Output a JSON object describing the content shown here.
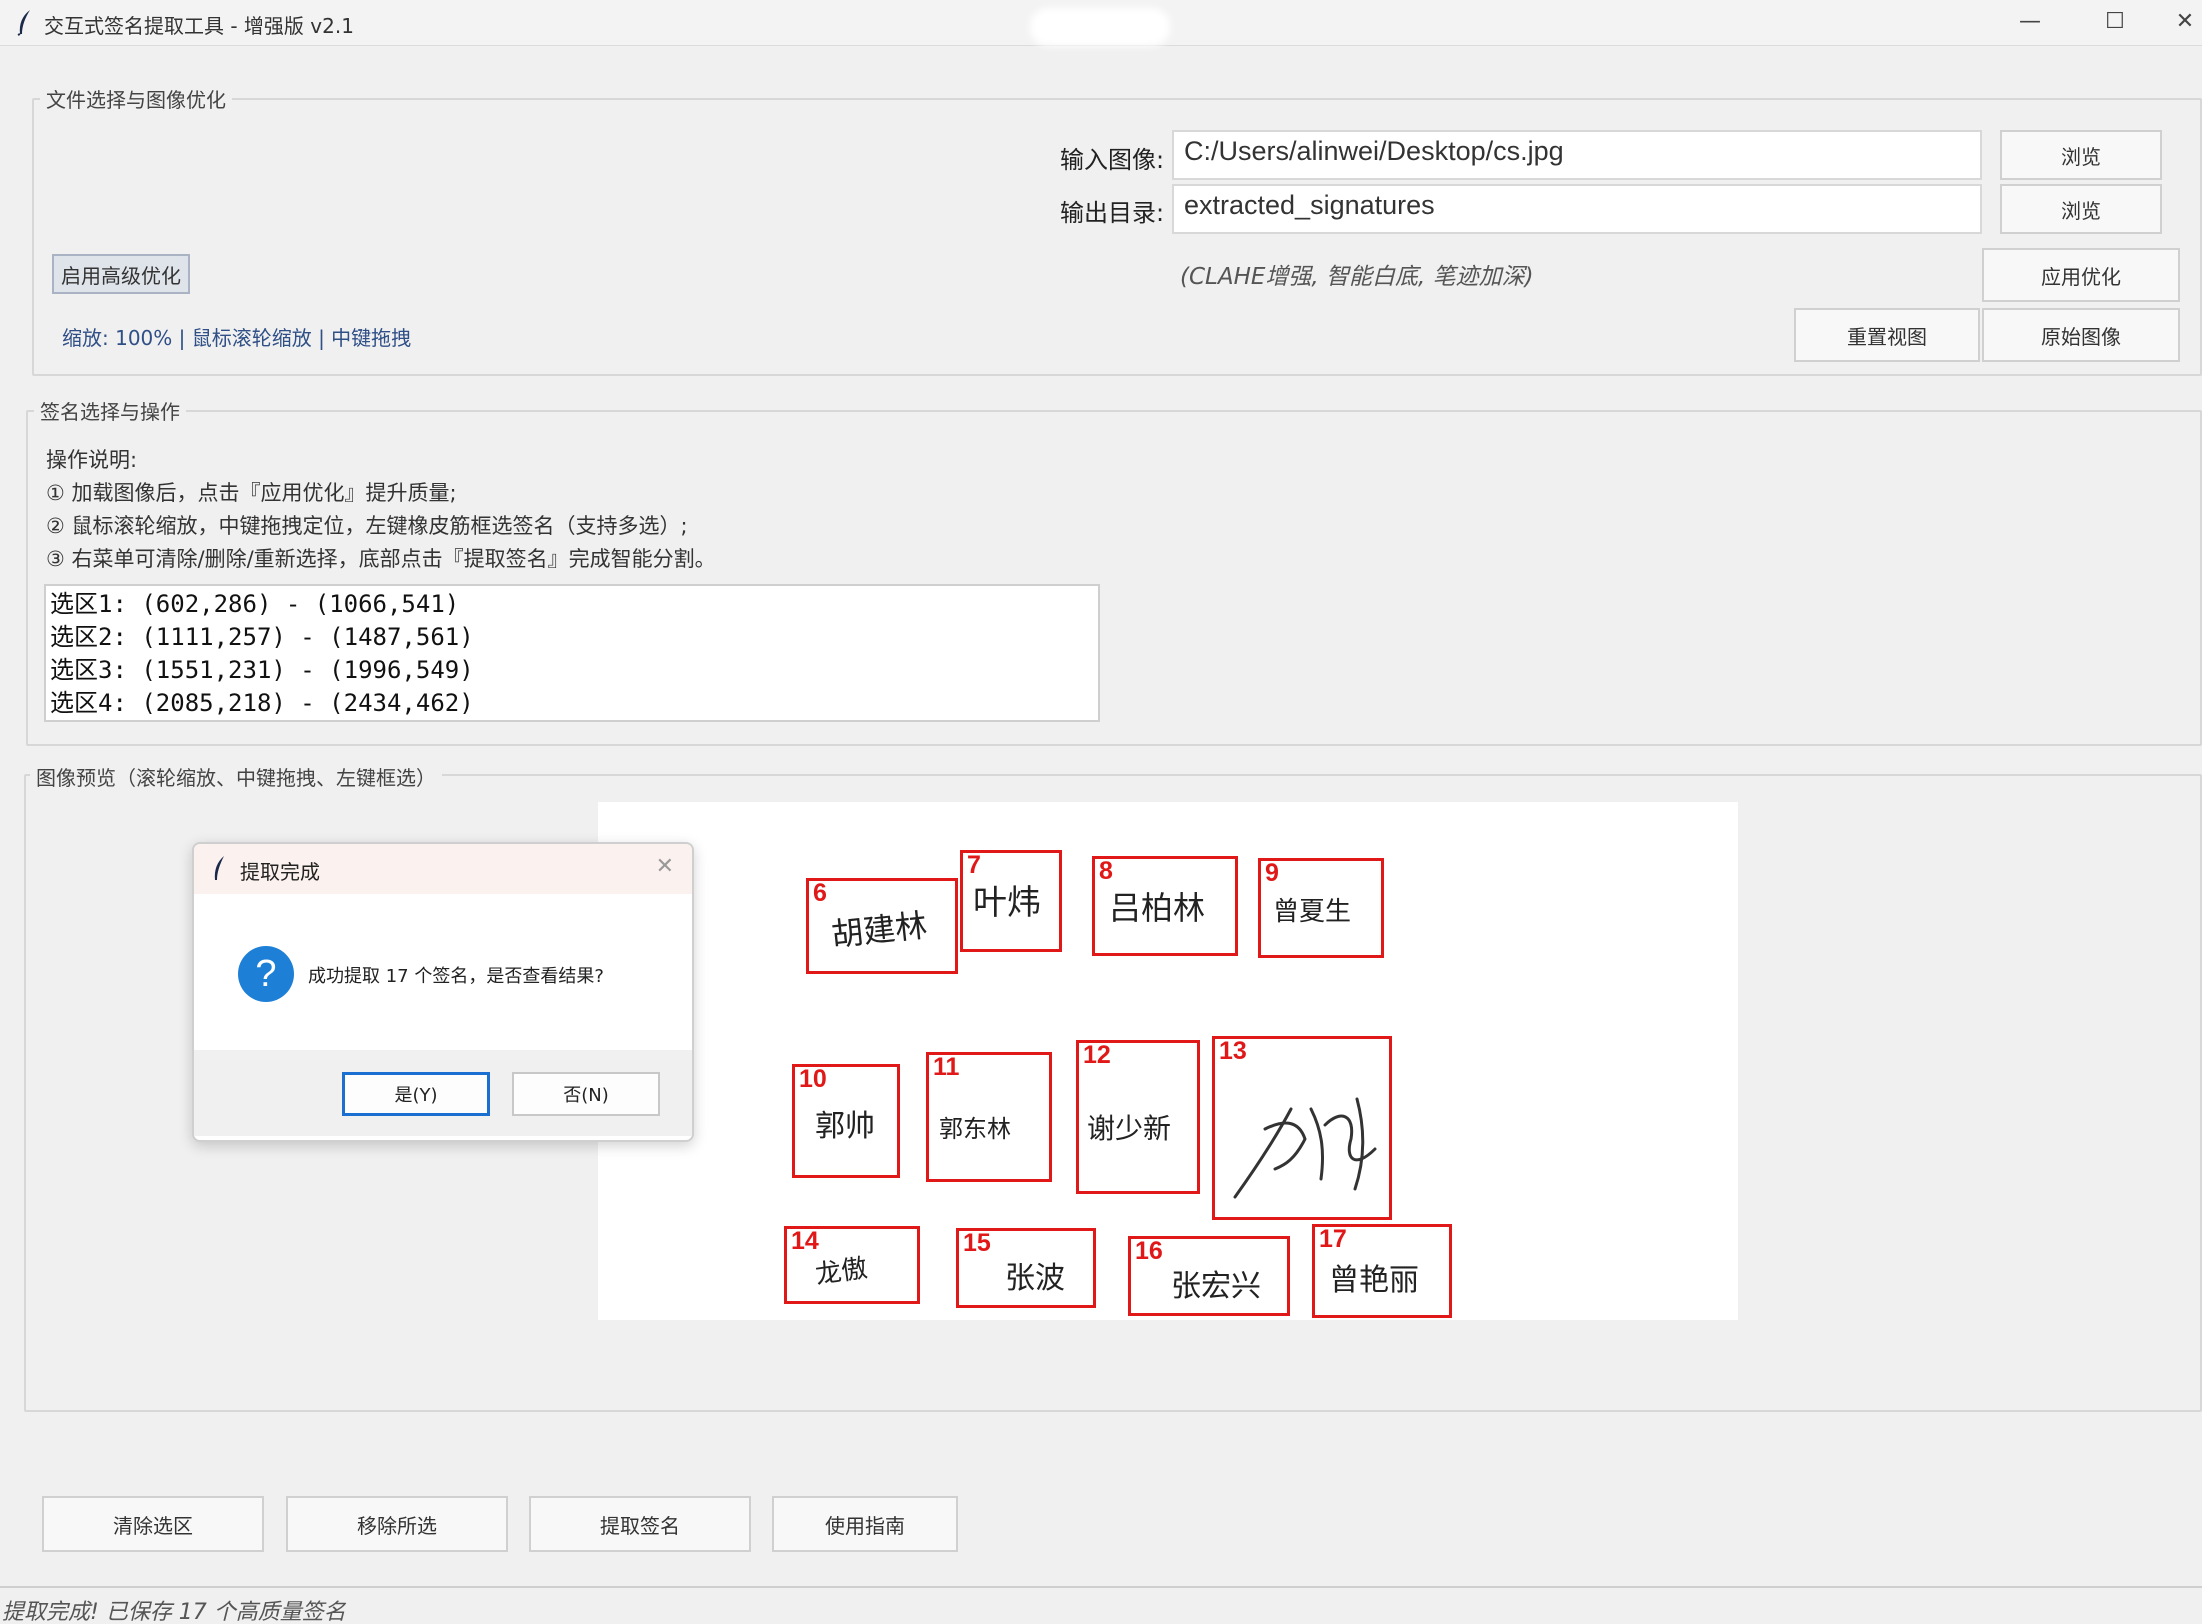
{
  "window": {
    "title": "交互式签名提取工具 - 增强版 v2.1",
    "min_glyph": "—",
    "max_glyph": "☐",
    "close_glyph": "✕"
  },
  "file_group": {
    "label": "文件选择与图像优化",
    "input_label": "输入图像:",
    "input_value": "C:/Users/alinwei/Desktop/cs.jpg",
    "output_label": "输出目录:",
    "output_value": "extracted_signatures",
    "browse_label": "浏览",
    "advanced_label": "启用高级优化",
    "hint": "(CLAHE增强, 智能白底, 笔迹加深)",
    "apply_label": "应用优化",
    "zoom_info": "缩放: 100% | 鼠标滚轮缩放 | 中键拖拽",
    "reset_label": "重置视图",
    "original_label": "原始图像"
  },
  "select_group": {
    "label": "签名选择与操作",
    "instructions": [
      "操作说明:",
      "① 加载图像后，点击『应用优化』提升质量;",
      "② 鼠标滚轮缩放，中键拖拽定位，左键橡皮筋框选签名（支持多选）;",
      "③ 右菜单可清除/删除/重新选择，底部点击『提取签名』完成智能分割。"
    ],
    "selections": [
      "选区1: (602,286) - (1066,541)",
      "选区2: (1111,257) - (1487,561)",
      "选区3: (1551,231) - (1996,549)",
      "选区4: (2085,218) - (2434,462)"
    ]
  },
  "preview_group": {
    "label": "图像预览（滚轮缩放、中键拖拽、左键框选）",
    "signatures": [
      {
        "num": "6",
        "name": "胡建林"
      },
      {
        "num": "7",
        "name": "叶炜"
      },
      {
        "num": "8",
        "name": "吕柏林"
      },
      {
        "num": "9",
        "name": "曾夏生"
      },
      {
        "num": "10",
        "name": "郭帅"
      },
      {
        "num": "11",
        "name": "郭东林"
      },
      {
        "num": "12",
        "name": "谢少新"
      },
      {
        "num": "13",
        "name": ""
      },
      {
        "num": "14",
        "name": "龙傲"
      },
      {
        "num": "15",
        "name": "张波"
      },
      {
        "num": "16",
        "name": "张宏兴"
      },
      {
        "num": "17",
        "name": "曾艳丽"
      }
    ]
  },
  "dialog": {
    "title": "提取完成",
    "message": "成功提取 17 个签名，是否查看结果?",
    "yes_label": "是(Y)",
    "no_label": "否(N)",
    "close_glyph": "✕",
    "icon_glyph": "?"
  },
  "bottom_buttons": {
    "clear": "清除选区",
    "remove": "移除所选",
    "extract": "提取签名",
    "guide": "使用指南"
  },
  "status": "提取完成! 已保存 17 个高质量签名",
  "colors": {
    "box_red": "#e01818",
    "accent_blue": "#1e7fd6"
  }
}
